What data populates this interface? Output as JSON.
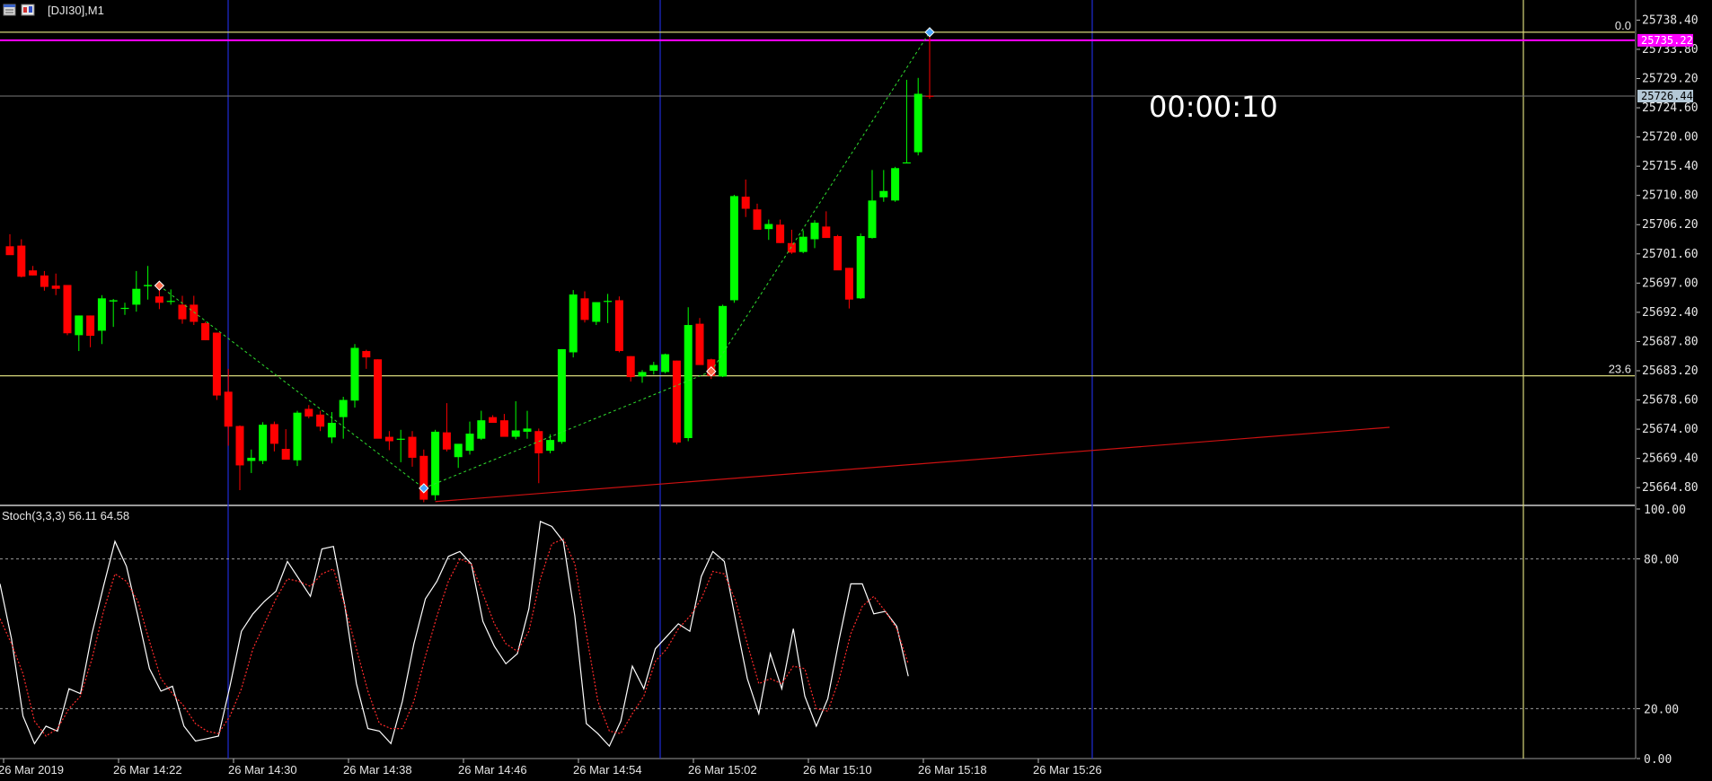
{
  "window": {
    "title": "[DJI30],M1"
  },
  "countdown": "00:00:10",
  "colors": {
    "background": "#000000",
    "bull": "#00ff00",
    "bear": "#ff0000",
    "grid_vertical": "#1f2bd6",
    "yellow_line": "#d6d67a",
    "bid_line": "#ff00ff",
    "ask_tag": "#b4c8d6",
    "trendline": "#cc1111",
    "stoch_main": "#ffffff",
    "stoch_signal": "#ff2a2a",
    "fib_line": "#7a7a7a"
  },
  "icons": [
    "window-icon",
    "chart-icon"
  ],
  "chart_data": [
    {
      "type": "candlestick",
      "symbol": "DJI30",
      "timeframe": "M1",
      "y_ticks": [
        "25738.40",
        "25733.80",
        "25729.20",
        "25724.60",
        "25720.00",
        "25715.40",
        "25710.80",
        "25706.20",
        "25701.60",
        "25697.00",
        "25692.40",
        "25687.80",
        "25683.20",
        "25678.60",
        "25674.00",
        "25669.40",
        "25664.80"
      ],
      "ylim": [
        25662,
        25741
      ],
      "price_tags": [
        {
          "label": "25735.22",
          "value": 25735.22,
          "kind": "bid"
        },
        {
          "label": "25726.44",
          "value": 25726.44,
          "kind": "ask"
        }
      ],
      "fibo_levels": [
        {
          "label": "0.0",
          "value": 25736.5
        },
        {
          "label": "23.6",
          "value": 25682.4
        }
      ],
      "candles": [
        {
          "o": 25702.8,
          "h": 25704.7,
          "l": 25702.7,
          "c": 25701.4
        },
        {
          "o": 25702.9,
          "h": 25703.9,
          "l": 25697.9,
          "c": 25698.0
        },
        {
          "o": 25699.0,
          "h": 25699.7,
          "l": 25698.2,
          "c": 25698.2
        },
        {
          "o": 25698.2,
          "h": 25698.9,
          "l": 25695.8,
          "c": 25696.4
        },
        {
          "o": 25696.6,
          "h": 25698.5,
          "l": 25695.1,
          "c": 25696.1
        },
        {
          "o": 25696.7,
          "h": 25696.7,
          "l": 25688.8,
          "c": 25689.1
        },
        {
          "o": 25688.8,
          "h": 25691.9,
          "l": 25686.3,
          "c": 25691.9
        },
        {
          "o": 25691.9,
          "h": 25691.9,
          "l": 25686.9,
          "c": 25688.7
        },
        {
          "o": 25689.5,
          "h": 25695.1,
          "l": 25687.4,
          "c": 25694.6
        },
        {
          "o": 25694.1,
          "h": 25694.5,
          "l": 25690.1,
          "c": 25694.3
        },
        {
          "o": 25693.1,
          "h": 25693.9,
          "l": 25692.0,
          "c": 25693.1
        },
        {
          "o": 25693.6,
          "h": 25698.9,
          "l": 25692.5,
          "c": 25696.1
        },
        {
          "o": 25696.5,
          "h": 25699.7,
          "l": 25694.4,
          "c": 25696.7
        },
        {
          "o": 25694.9,
          "h": 25696.8,
          "l": 25692.9,
          "c": 25693.9
        },
        {
          "o": 25694.2,
          "h": 25696.0,
          "l": 25693.6,
          "c": 25694.2
        },
        {
          "o": 25693.6,
          "h": 25695.0,
          "l": 25690.6,
          "c": 25691.3
        },
        {
          "o": 25693.6,
          "h": 25695.0,
          "l": 25690.4,
          "c": 25690.9
        },
        {
          "o": 25690.7,
          "h": 25690.9,
          "l": 25688.0,
          "c": 25688.0
        },
        {
          "o": 25689.2,
          "h": 25689.2,
          "l": 25678.6,
          "c": 25679.3
        },
        {
          "o": 25679.9,
          "h": 25683.5,
          "l": 25671.4,
          "c": 25674.4
        },
        {
          "o": 25674.5,
          "h": 25674.6,
          "l": 25664.4,
          "c": 25668.3
        },
        {
          "o": 25669.0,
          "h": 25670.8,
          "l": 25667.1,
          "c": 25669.5
        },
        {
          "o": 25669.0,
          "h": 25675.1,
          "l": 25668.5,
          "c": 25674.7
        },
        {
          "o": 25674.8,
          "h": 25675.2,
          "l": 25670.5,
          "c": 25671.7
        },
        {
          "o": 25670.9,
          "h": 25674.0,
          "l": 25670.4,
          "c": 25669.2
        },
        {
          "o": 25669.1,
          "h": 25676.9,
          "l": 25668.2,
          "c": 25676.6
        },
        {
          "o": 25677.2,
          "h": 25677.8,
          "l": 25675.7,
          "c": 25676.0
        },
        {
          "o": 25676.3,
          "h": 25676.9,
          "l": 25673.7,
          "c": 25674.4
        },
        {
          "o": 25672.7,
          "h": 25676.7,
          "l": 25671.8,
          "c": 25675.0
        },
        {
          "o": 25675.9,
          "h": 25679.1,
          "l": 25672.5,
          "c": 25678.6
        },
        {
          "o": 25678.5,
          "h": 25687.4,
          "l": 25677.4,
          "c": 25686.8
        },
        {
          "o": 25686.3,
          "h": 25686.5,
          "l": 25683.5,
          "c": 25685.3
        },
        {
          "o": 25685.0,
          "h": 25685.0,
          "l": 25672.8,
          "c": 25672.5
        },
        {
          "o": 25672.8,
          "h": 25673.7,
          "l": 25670.7,
          "c": 25672.1
        },
        {
          "o": 25672.5,
          "h": 25673.9,
          "l": 25668.8,
          "c": 25672.5
        },
        {
          "o": 25672.8,
          "h": 25673.7,
          "l": 25668.1,
          "c": 25669.5
        },
        {
          "o": 25669.8,
          "h": 25670.8,
          "l": 25662.5,
          "c": 25662.9
        },
        {
          "o": 25663.6,
          "h": 25673.9,
          "l": 25662.8,
          "c": 25673.6
        },
        {
          "o": 25673.5,
          "h": 25678.1,
          "l": 25670.5,
          "c": 25670.8
        },
        {
          "o": 25669.6,
          "h": 25671.5,
          "l": 25667.9,
          "c": 25671.7
        },
        {
          "o": 25670.6,
          "h": 25675.2,
          "l": 25670.0,
          "c": 25673.3
        },
        {
          "o": 25672.5,
          "h": 25676.9,
          "l": 25672.3,
          "c": 25675.4
        },
        {
          "o": 25675.9,
          "h": 25676.2,
          "l": 25675.3,
          "c": 25675.0
        },
        {
          "o": 25675.4,
          "h": 25676.4,
          "l": 25674.2,
          "c": 25672.8
        },
        {
          "o": 25672.8,
          "h": 25678.4,
          "l": 25672.4,
          "c": 25673.8
        },
        {
          "o": 25673.6,
          "h": 25676.9,
          "l": 25672.5,
          "c": 25674.1
        },
        {
          "o": 25673.7,
          "h": 25674.1,
          "l": 25665.5,
          "c": 25670.2
        },
        {
          "o": 25670.6,
          "h": 25673.2,
          "l": 25670.2,
          "c": 25672.3
        },
        {
          "o": 25672.0,
          "h": 25686.6,
          "l": 25671.7,
          "c": 25686.6
        },
        {
          "o": 25686.1,
          "h": 25695.9,
          "l": 25685.3,
          "c": 25695.2
        },
        {
          "o": 25694.6,
          "h": 25695.7,
          "l": 25690.8,
          "c": 25691.2
        },
        {
          "o": 25690.9,
          "h": 25693.8,
          "l": 25690.4,
          "c": 25694.0
        },
        {
          "o": 25694.1,
          "h": 25695.3,
          "l": 25690.7,
          "c": 25694.2
        },
        {
          "o": 25694.3,
          "h": 25694.9,
          "l": 25686.1,
          "c": 25686.3
        },
        {
          "o": 25685.5,
          "h": 25685.5,
          "l": 25681.5,
          "c": 25682.2
        },
        {
          "o": 25682.3,
          "h": 25683.3,
          "l": 25681.3,
          "c": 25683.0
        },
        {
          "o": 25683.2,
          "h": 25684.6,
          "l": 25682.6,
          "c": 25684.1
        },
        {
          "o": 25683.0,
          "h": 25685.9,
          "l": 25682.8,
          "c": 25685.8
        },
        {
          "o": 25684.8,
          "h": 25684.8,
          "l": 25671.6,
          "c": 25671.9
        },
        {
          "o": 25672.6,
          "h": 25693.2,
          "l": 25672.1,
          "c": 25690.4
        },
        {
          "o": 25690.6,
          "h": 25691.5,
          "l": 25684.4,
          "c": 25684.1
        },
        {
          "o": 25685.0,
          "h": 25685.1,
          "l": 25681.9,
          "c": 25682.4
        },
        {
          "o": 25682.3,
          "h": 25693.6,
          "l": 25682.2,
          "c": 25693.4
        },
        {
          "o": 25694.3,
          "h": 25710.9,
          "l": 25693.9,
          "c": 25710.7
        },
        {
          "o": 25710.6,
          "h": 25713.3,
          "l": 25707.4,
          "c": 25708.7
        },
        {
          "o": 25708.6,
          "h": 25709.5,
          "l": 25705.4,
          "c": 25705.4
        },
        {
          "o": 25705.5,
          "h": 25707.0,
          "l": 25703.8,
          "c": 25706.3
        },
        {
          "o": 25706.2,
          "h": 25707.0,
          "l": 25703.3,
          "c": 25703.3
        },
        {
          "o": 25703.3,
          "h": 25705.4,
          "l": 25701.6,
          "c": 25701.8
        },
        {
          "o": 25701.9,
          "h": 25705.3,
          "l": 25701.7,
          "c": 25704.3
        },
        {
          "o": 25703.9,
          "h": 25706.9,
          "l": 25702.5,
          "c": 25706.5
        },
        {
          "o": 25705.9,
          "h": 25708.3,
          "l": 25705.5,
          "c": 25704.1
        },
        {
          "o": 25704.4,
          "h": 25704.6,
          "l": 25699.1,
          "c": 25699.0
        },
        {
          "o": 25699.4,
          "h": 25699.4,
          "l": 25693.0,
          "c": 25694.4
        },
        {
          "o": 25694.6,
          "h": 25704.8,
          "l": 25694.5,
          "c": 25704.4
        },
        {
          "o": 25704.1,
          "h": 25714.8,
          "l": 25704.0,
          "c": 25710.0
        },
        {
          "o": 25710.5,
          "h": 25714.8,
          "l": 25709.8,
          "c": 25711.5
        },
        {
          "o": 25710.0,
          "h": 25715.3,
          "l": 25709.8,
          "c": 25715.1
        },
        {
          "o": 25716.0,
          "h": 25729.0,
          "l": 25716.0,
          "c": 25716.0
        },
        {
          "o": 25717.6,
          "h": 25729.3,
          "l": 25717.1,
          "c": 25726.8
        },
        {
          "o": 25726.5,
          "h": 25736.6,
          "l": 25726.0,
          "c": 25726.4
        }
      ],
      "zigzag": [
        {
          "label": "25697.0",
          "index": 13,
          "price": 25696.6
        },
        {
          "label": "25666.0",
          "index": 36,
          "price": 25664.7
        },
        {
          "label": "25684.1",
          "index": 61,
          "price": 25683.1
        },
        {
          "label": "25736.5",
          "index": 80,
          "price": 25736.5
        }
      ],
      "trendline": {
        "from": {
          "index": 37,
          "price": 25662.6
        },
        "to": {
          "index": 120,
          "price": 25674.3
        }
      }
    },
    {
      "type": "line",
      "indicator": "Stoch(3,3,3)",
      "label": "Stoch(3,3,3) 56.11 64.58",
      "y_ticks": [
        "100.00",
        "80.00",
        "20.00",
        "0.00"
      ],
      "ylim": [
        0,
        100
      ],
      "levels": [
        80,
        20
      ],
      "series": [
        {
          "key": "main",
          "values": [
            70,
            48,
            17,
            6,
            13,
            11,
            28,
            26,
            50,
            69,
            87,
            77,
            57,
            36,
            27,
            29,
            13,
            7,
            8,
            9,
            29,
            51,
            58,
            63,
            67,
            79,
            72,
            65,
            84,
            85,
            61,
            30,
            12,
            11,
            6,
            23,
            46,
            64,
            71,
            81,
            83,
            78,
            55,
            45,
            38,
            42,
            60,
            95,
            93,
            87,
            57,
            14,
            10,
            5,
            15,
            37,
            28,
            44,
            49,
            54,
            51,
            73,
            83,
            79,
            55,
            32,
            18,
            42,
            28,
            52,
            25,
            13,
            24,
            48,
            70,
            70,
            58,
            59,
            53,
            33
          ]
        },
        {
          "key": "signal",
          "values": [
            56,
            46,
            34,
            15,
            9,
            12,
            20,
            25,
            40,
            59,
            74,
            71,
            63,
            47,
            32,
            26,
            21,
            14,
            11,
            10,
            17,
            28,
            44,
            54,
            64,
            72,
            71,
            69,
            74,
            76,
            61,
            44,
            27,
            14,
            12,
            12,
            23,
            41,
            57,
            71,
            80,
            78,
            66,
            54,
            46,
            43,
            51,
            72,
            86,
            88,
            78,
            50,
            23,
            11,
            10,
            18,
            25,
            39,
            44,
            52,
            57,
            64,
            75,
            74,
            63,
            46,
            30,
            32,
            30,
            37,
            36,
            20,
            19,
            32,
            50,
            61,
            65,
            59,
            52,
            38
          ]
        }
      ]
    }
  ],
  "time_axis": {
    "labels": [
      "26 Mar 2019",
      "26 Mar 14:22",
      "26 Mar 14:30",
      "26 Mar 14:38",
      "26 Mar 14:46",
      "26 Mar 14:54",
      "26 Mar 15:02",
      "26 Mar 15:10",
      "26 Mar 15:18",
      "26 Mar 15:26"
    ]
  }
}
